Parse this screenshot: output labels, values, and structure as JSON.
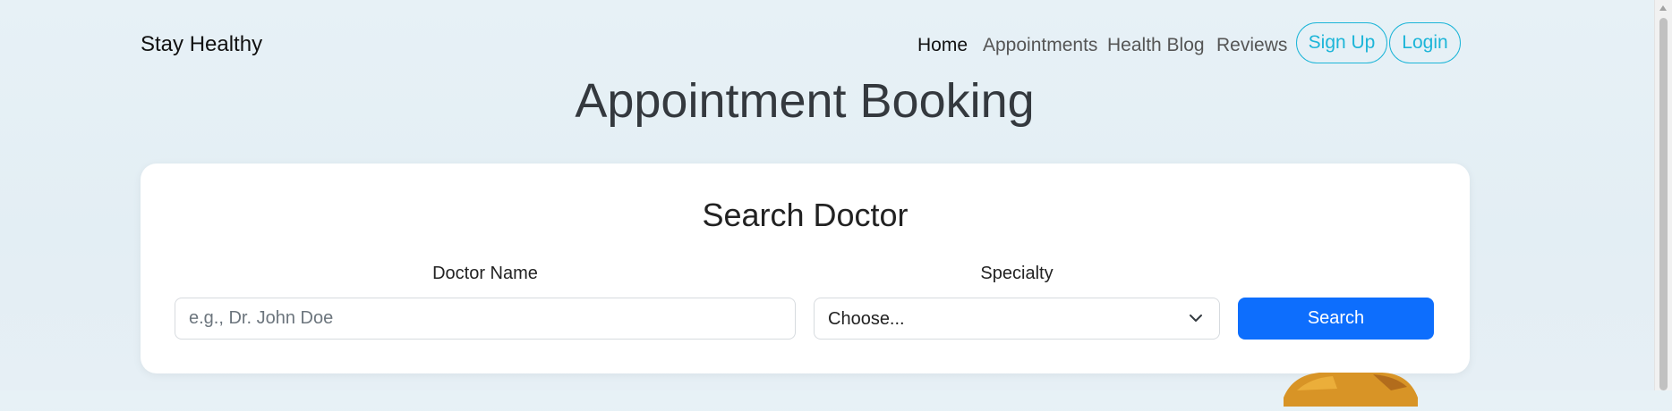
{
  "brand": "Stay Healthy",
  "nav": {
    "links": [
      {
        "label": "Home",
        "active": true
      },
      {
        "label": "Appointments",
        "active": false
      },
      {
        "label": "Health Blog",
        "active": false
      },
      {
        "label": "Reviews",
        "active": false
      }
    ],
    "signup_label": "Sign Up",
    "login_label": "Login"
  },
  "page_title": "Appointment Booking",
  "search": {
    "title": "Search Doctor",
    "doctor_name_label": "Doctor Name",
    "doctor_name_placeholder": "e.g., Dr. John Doe",
    "doctor_name_value": "",
    "specialty_label": "Specialty",
    "specialty_selected": "Choose...",
    "button_label": "Search"
  },
  "colors": {
    "accent": "#1cb5d8",
    "primary_button": "#0d6efd",
    "title_text": "#34393e"
  },
  "icons": {
    "select": "chevron-down-icon"
  }
}
